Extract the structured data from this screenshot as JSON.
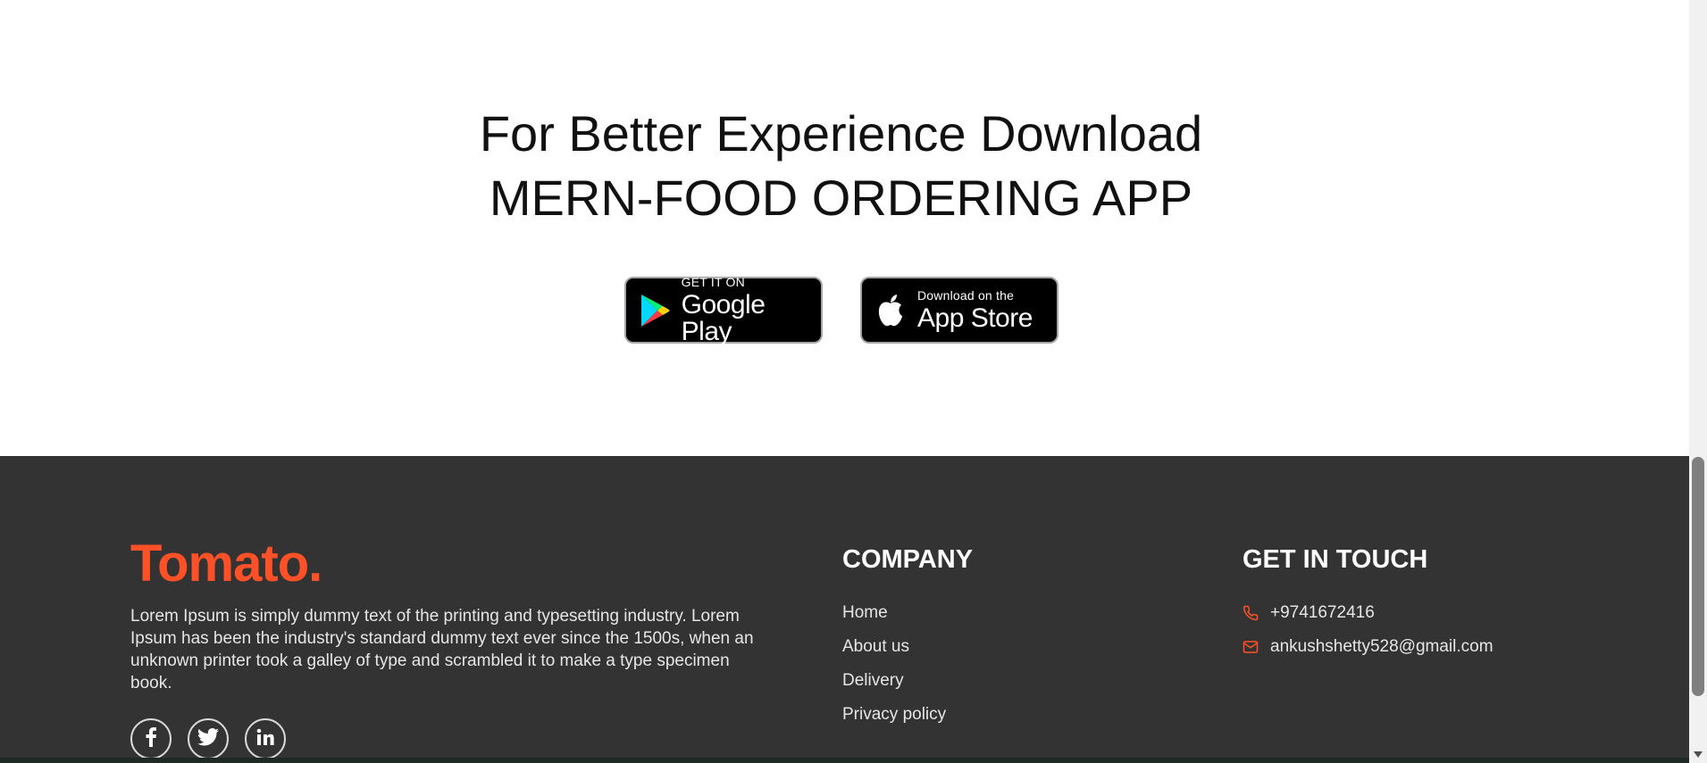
{
  "app_download": {
    "title_line1": "For Better Experience Download",
    "title_line2": "MERN-FOOD ORDERING APP",
    "google_play": {
      "small": "GET IT ON",
      "big": "Google Play"
    },
    "app_store": {
      "small": "Download on the",
      "big": "App Store"
    }
  },
  "footer": {
    "brand": "Tomato.",
    "description": "Lorem Ipsum is simply dummy text of the printing and typesetting industry. Lorem Ipsum has been the industry's standard dummy text ever since the 1500s, when an unknown printer took a galley of type and scrambled it to make a type specimen book.",
    "socials": [
      {
        "icon": "facebook-icon",
        "glyph": "f"
      },
      {
        "icon": "twitter-icon",
        "glyph": ""
      },
      {
        "icon": "linkedin-icon",
        "glyph": "in"
      }
    ],
    "company": {
      "title": "COMPANY",
      "links": [
        "Home",
        "About us",
        "Delivery",
        "Privacy policy"
      ]
    },
    "get_in_touch": {
      "title": "GET IN TOUCH",
      "phone": "+9741672416",
      "email": "ankushshetty528@gmail.com"
    }
  },
  "colors": {
    "brand": "#ff5128",
    "footer_bg": "#333333",
    "contact_icon": "#ff5128"
  }
}
